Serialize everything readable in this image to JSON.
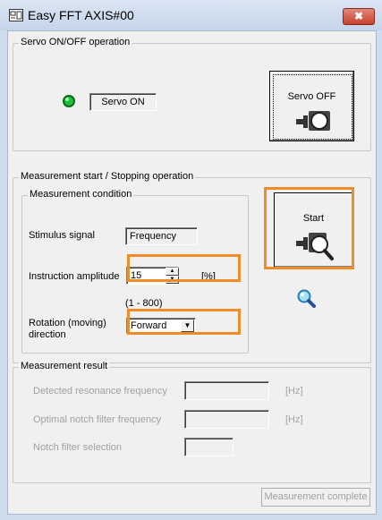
{
  "window": {
    "title": "Easy FFT AXIS#00",
    "close_glyph": "✖"
  },
  "servo_group": {
    "legend": "Servo ON/OFF operation",
    "status_text": "Servo ON",
    "indicator_color": "#1fbf3a",
    "servo_off_button": "Servo OFF"
  },
  "measure_group": {
    "legend": "Measurement start / Stopping operation",
    "condition_legend": "Measurement condition",
    "stimulus_label": "Stimulus signal",
    "stimulus_value": "Frequency",
    "amplitude_label": "Instruction amplitude",
    "amplitude_value": "15",
    "amplitude_unit": "[%]",
    "amplitude_range": "(1 - 800)",
    "rotation_label_line1": "Rotation (moving)",
    "rotation_label_line2": "direction",
    "rotation_value": "Forward",
    "start_button": "Start",
    "highlight_color": "#f08c28"
  },
  "result_group": {
    "legend": "Measurement result",
    "resonance_label": "Detected resonance frequency",
    "resonance_value": "",
    "resonance_unit": "[Hz]",
    "notch_freq_label": "Optimal notch filter frequency",
    "notch_freq_value": "",
    "notch_freq_unit": "[Hz]",
    "notch_sel_label": "Notch filter selection",
    "notch_sel_value": ""
  },
  "footer": {
    "complete_button": "Measurement complete"
  },
  "icons": [
    "app-icon",
    "close-icon",
    "servo-led-icon",
    "motor-icon",
    "motor-magnifier-icon",
    "magnifier-icon",
    "spin-up-icon",
    "spin-down-icon",
    "dropdown-arrow-icon"
  ]
}
